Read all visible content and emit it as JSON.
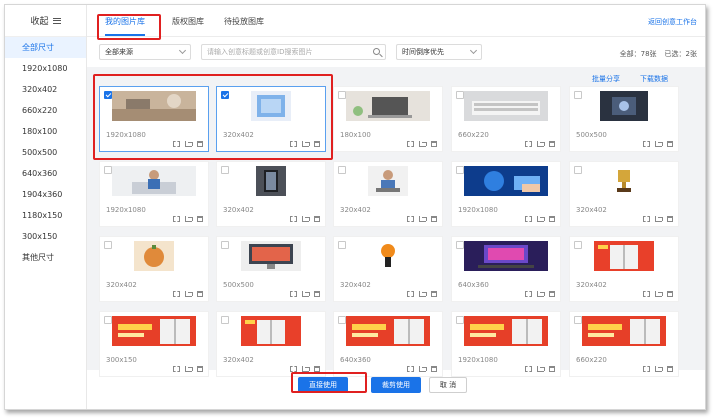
{
  "sidebar": {
    "title": "收起",
    "items": [
      {
        "label": "全部尺寸",
        "active": true
      },
      {
        "label": "1920x1080"
      },
      {
        "label": "320x402"
      },
      {
        "label": "660x220"
      },
      {
        "label": "180x100"
      },
      {
        "label": "500x500"
      },
      {
        "label": "640x360"
      },
      {
        "label": "1904x360"
      },
      {
        "label": "1180x150"
      },
      {
        "label": "300x150"
      },
      {
        "label": "其他尺寸"
      }
    ]
  },
  "tabs": [
    {
      "label": "我的图片库",
      "active": true
    },
    {
      "label": "版权图库"
    },
    {
      "label": "待投放图库"
    }
  ],
  "return_link": "返回创意工作台",
  "filters": {
    "source": "全部来源",
    "search_placeholder": "请输入创意标题或创意ID搜索图片",
    "sort": "时间倒序优先"
  },
  "counts": {
    "total": "全部：78张",
    "selected": "已选：2张"
  },
  "actions": {
    "share": "批量分享",
    "download": "下载数据"
  },
  "cards": [
    {
      "size": "1920x1080",
      "checked": true,
      "thumb": "desk-photo"
    },
    {
      "size": "320x402",
      "checked": true,
      "thumb": "blue-device"
    },
    {
      "size": "180x100",
      "checked": false,
      "thumb": "laptop-desk"
    },
    {
      "size": "660x220",
      "checked": false,
      "thumb": "keyboard"
    },
    {
      "size": "500x500",
      "checked": false,
      "thumb": "dark-device"
    },
    {
      "size": "1920x1080",
      "checked": false,
      "thumb": "man-couch"
    },
    {
      "size": "320x402",
      "checked": false,
      "thumb": "phone-hand"
    },
    {
      "size": "320x402",
      "checked": false,
      "thumb": "man-laptop"
    },
    {
      "size": "1920x1080",
      "checked": false,
      "thumb": "digital-touch"
    },
    {
      "size": "320x402",
      "checked": false,
      "thumb": "trophy"
    },
    {
      "size": "320x402",
      "checked": false,
      "thumb": "pumpkin-bread"
    },
    {
      "size": "500x500",
      "checked": false,
      "thumb": "monitor-display"
    },
    {
      "size": "320x402",
      "checked": false,
      "thumb": "pumpkin-figure"
    },
    {
      "size": "640x360",
      "checked": false,
      "thumb": "gaming-setup"
    },
    {
      "size": "320x402",
      "checked": false,
      "thumb": "fridge-promo"
    },
    {
      "size": "300x150",
      "checked": false,
      "thumb": "fridge-banner"
    },
    {
      "size": "320x402",
      "checked": false,
      "thumb": "fridge-promo"
    },
    {
      "size": "640x360",
      "checked": false,
      "thumb": "fridge-banner"
    },
    {
      "size": "1920x1080",
      "checked": false,
      "thumb": "fridge-banner"
    },
    {
      "size": "660x220",
      "checked": false,
      "thumb": "fridge-banner"
    }
  ],
  "footer": {
    "direct": "直接使用",
    "edit": "裁剪使用",
    "cancel": "取 消"
  },
  "colors": {
    "accent": "#1a73e8",
    "highlight": "#e02020",
    "selected_border": "#5aa0ef"
  }
}
